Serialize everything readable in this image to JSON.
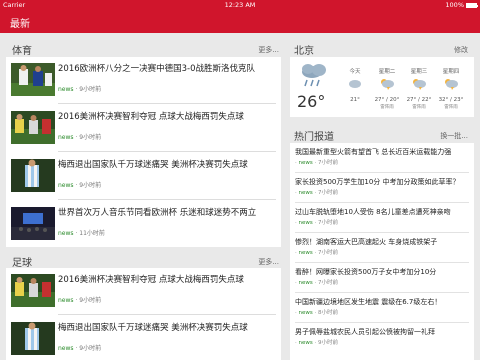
{
  "status": {
    "carrier": "Carrier",
    "time": "12:23 AM",
    "battery": "100%"
  },
  "nav": {
    "title": "最新"
  },
  "sections": {
    "sports": {
      "label": "体育",
      "more": "更多..."
    },
    "football": {
      "label": "足球",
      "more": "更多..."
    },
    "weather": {
      "label": "北京",
      "edit": "修改"
    },
    "hot": {
      "label": "热门报道",
      "more": "换一批..."
    }
  },
  "sports_news": [
    {
      "title": "2016欧洲杯八分之一决赛中德国3-0战胜斯洛伐克队",
      "source": "news",
      "time": "9小时前"
    },
    {
      "title": "2016美洲杯决赛智利夺冠 点球大战梅西罚失点球",
      "source": "news",
      "time": "9小时前"
    },
    {
      "title": "梅西退出国家队千万球迷痛哭 美洲杯决赛罚失点球",
      "source": "news",
      "time": "9小时前"
    },
    {
      "title": "世界首次万人音乐节同看欧洲杯 乐迷和球迷势不两立",
      "source": "news",
      "time": "11小时前"
    }
  ],
  "football_news": [
    {
      "title": "2016美洲杯决赛智利夺冠 点球大战梅西罚失点球",
      "source": "news",
      "time": "9小时前"
    },
    {
      "title": "梅西退出国家队千万球迷痛哭 美洲杯决赛罚失点球",
      "source": "news",
      "time": "9小时前"
    }
  ],
  "weather": {
    "today_temp": "26°",
    "today": {
      "name": "今天",
      "range": "21°"
    },
    "days": [
      {
        "name": "星期二",
        "range": "27° / 20°",
        "wind": "雷阵雨"
      },
      {
        "name": "星期三",
        "range": "27° / 22°",
        "wind": "雷阵雨"
      },
      {
        "name": "星期四",
        "range": "32° / 23°",
        "wind": "雷阵雨"
      }
    ]
  },
  "hot_news": [
    {
      "title": "我国最新重型火箭有望首飞 总长近百米运载能力强",
      "source": "news",
      "time": "7小时前"
    },
    {
      "title": "家长投资500万学生加10分 中考加分政策如此草率？",
      "source": "news",
      "time": "7小时前"
    },
    {
      "title": "过山车脱轨堕地10人受伤 8名儿童差点遭死神亲吻",
      "source": "news",
      "time": "7小时前"
    },
    {
      "title": "惨烈！湖南客运大巴高速起火 车身烧成铁架子",
      "source": "news",
      "time": "7小时前"
    },
    {
      "title": "看醉！网曝家长投资500万子女中考加分10分",
      "source": "news",
      "time": "7小时前"
    },
    {
      "title": "中国新疆边境地区发生地震 震级在6.7级左右！",
      "source": "news",
      "time": "8小时前"
    },
    {
      "title": "男子佩辱盐城农民人员引起公愤被拘留一礼拜",
      "source": "news",
      "time": "9小时前"
    }
  ],
  "colors": {
    "brand": "#d0152c",
    "source": "#2a8a2a"
  }
}
